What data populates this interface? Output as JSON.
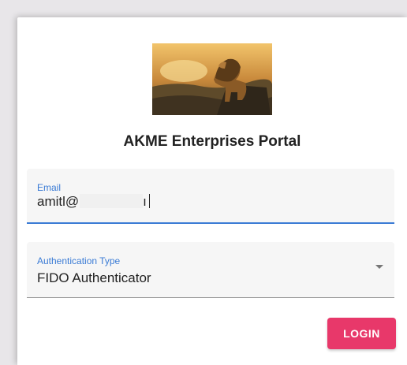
{
  "app": {
    "title": "AKME Enterprises Portal"
  },
  "logo": {
    "icon": "lion-on-rock-image"
  },
  "form": {
    "email": {
      "label": "Email",
      "value_prefix": "amitl@",
      "value_suffix": "ı"
    },
    "auth_type": {
      "label": "Authentication Type",
      "value": "FIDO Authenticator"
    },
    "login_label": "LOGIN"
  },
  "colors": {
    "accent": "#3a7bd5",
    "login_button": "#e8386a"
  }
}
